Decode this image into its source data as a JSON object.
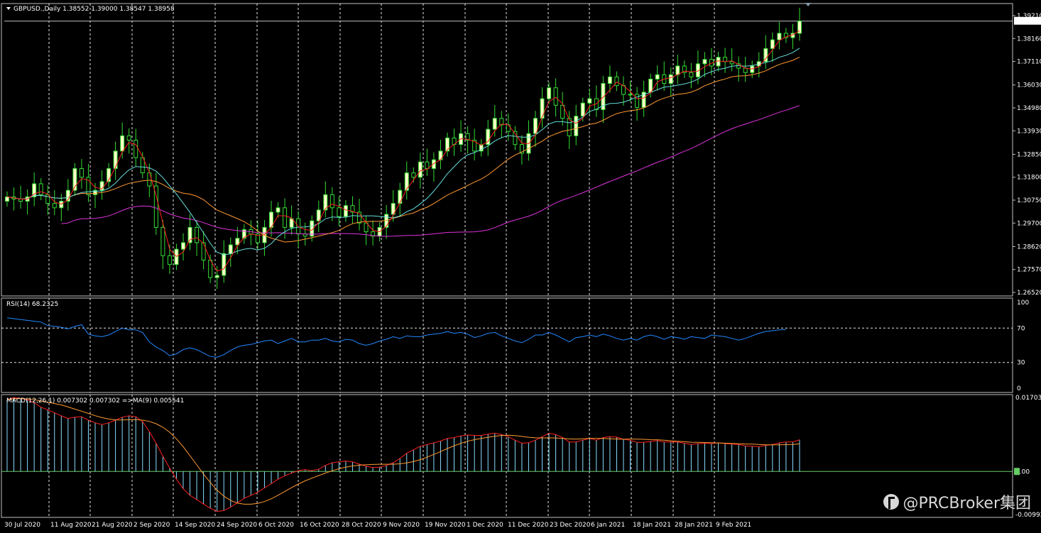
{
  "header": {
    "symbol_info": "GBPUSD.,Daily  1.38552 1.39000 1.38547 1.38958"
  },
  "rsi": {
    "label": "RSI(14) 68.2325",
    "levels": [
      "100",
      "70",
      "30",
      "0"
    ]
  },
  "macd": {
    "label": "MACD(12,26,1) 0.007302 0.007302  =>MA(9) 0.005541",
    "levels": [
      "0.017035",
      "0.00",
      "-0.00992"
    ]
  },
  "price_axis": {
    "labels": [
      "1.39210",
      "1.38160",
      "1.37110",
      "1.36030",
      "1.34980",
      "1.33930",
      "1.32850",
      "1.31800",
      "1.30750",
      "1.29700",
      "1.28620",
      "1.27570",
      "1.26520"
    ],
    "current": "1.38958"
  },
  "time_axis": {
    "labels": [
      "30 Jul 2020",
      "11 Aug 2020",
      "21 Aug 2020",
      "2 Sep 2020",
      "14 Sep 2020",
      "24 Sep 2020",
      "6 Oct 2020",
      "16 Oct 2020",
      "28 Oct 2020",
      "9 Nov 2020",
      "19 Nov 2020",
      "1 Dec 2020",
      "11 Dec 2020",
      "23 Dec 2020",
      "6 Jan 2021",
      "18 Jan 2021",
      "28 Jan 2021",
      "9 Feb 2021"
    ]
  },
  "watermark": {
    "text": "@PRCBroker集团"
  },
  "colors": {
    "bull": "#ffffc8",
    "bear": "#000000",
    "wick": "#33dd33",
    "ma_fast": "#ff2020",
    "ma_mid": "#66dddd",
    "ma_slow": "#ff9933",
    "ma_long": "#dd33dd",
    "rsi": "#2288ff",
    "macd_hist": "#88ddff",
    "macd_signal": "#ff9933",
    "macd_line": "#ff2020",
    "grid": "#ffffff"
  },
  "chart_data": [
    {
      "type": "candlestick",
      "title": "GBPUSD.,Daily",
      "categories": [
        "30 Jul 2020",
        "11 Aug 2020",
        "21 Aug 2020",
        "2 Sep 2020",
        "14 Sep 2020",
        "24 Sep 2020",
        "6 Oct 2020",
        "16 Oct 2020",
        "28 Oct 2020",
        "9 Nov 2020",
        "19 Nov 2020",
        "1 Dec 2020",
        "11 Dec 2020",
        "23 Dec 2020",
        "6 Jan 2021",
        "18 Jan 2021",
        "28 Jan 2021",
        "9 Feb 2021"
      ],
      "ylim": [
        1.2652,
        1.3921
      ],
      "series": [
        {
          "values": [
            1.309,
            1.308,
            1.307,
            1.309,
            1.315,
            1.31,
            1.306,
            1.304,
            1.307,
            1.312,
            1.322,
            1.318,
            1.31,
            1.312,
            1.316,
            1.322,
            1.33,
            1.337,
            1.335,
            1.327,
            1.32,
            1.314,
            1.295,
            1.282,
            1.278,
            1.285,
            1.288,
            1.295,
            1.288,
            1.28,
            1.272,
            1.273,
            1.283,
            1.287,
            1.29,
            1.294,
            1.292,
            1.288,
            1.295,
            1.302,
            1.304,
            1.295,
            1.299,
            1.292,
            1.291,
            1.298,
            1.303,
            1.31,
            1.304,
            1.3,
            1.305,
            1.302,
            1.297,
            1.293,
            1.291,
            1.295,
            1.301,
            1.306,
            1.312,
            1.32,
            1.318,
            1.325,
            1.322,
            1.326,
            1.33,
            1.336,
            1.333,
            1.338,
            1.335,
            1.33,
            1.333,
            1.34,
            1.345,
            1.342,
            1.339,
            1.333,
            1.329,
            1.338,
            1.345,
            1.354,
            1.359,
            1.351,
            1.345,
            1.337,
            1.346,
            1.352,
            1.354,
            1.349,
            1.361,
            1.364,
            1.36,
            1.356,
            1.356,
            1.35,
            1.357,
            1.363,
            1.365,
            1.361,
            1.365,
            1.369,
            1.366,
            1.364,
            1.37,
            1.372,
            1.369,
            1.373,
            1.371,
            1.37,
            1.368,
            1.366,
            1.369,
            1.371,
            1.377,
            1.381,
            1.384,
            1.382,
            1.384,
            1.3896
          ]
        }
      ]
    },
    {
      "type": "line",
      "title": "RSI(14) 68.2325",
      "ylim": [
        0,
        100
      ],
      "levels": [
        70,
        30
      ],
      "series": [
        {
          "values": [
            82,
            81,
            80,
            79,
            78,
            77,
            73,
            72,
            71,
            69,
            72,
            74,
            63,
            61,
            60,
            62,
            66,
            70,
            68,
            68,
            65,
            54,
            48,
            44,
            38,
            40,
            45,
            47,
            45,
            41,
            37,
            36,
            39,
            44,
            48,
            50,
            51,
            53,
            55,
            56,
            52,
            55,
            58,
            54,
            54,
            56,
            56,
            58,
            55,
            54,
            57,
            56,
            52,
            50,
            52,
            55,
            57,
            60,
            58,
            61,
            60,
            60,
            62,
            63,
            64,
            66,
            64,
            65,
            63,
            59,
            61,
            64,
            65,
            61,
            58,
            55,
            53,
            57,
            62,
            62,
            65,
            62,
            58,
            54,
            59,
            60,
            62,
            60,
            63,
            61,
            58,
            56,
            58,
            56,
            60,
            62,
            60,
            57,
            60,
            59,
            57,
            60,
            59,
            58,
            62,
            61,
            60,
            58,
            56,
            58,
            61,
            64,
            66,
            67,
            68,
            68.2325
          ]
        }
      ]
    },
    {
      "type": "bar",
      "title": "MACD(12,26,1) 0.007302 0.007302  =>MA(9) 0.005541",
      "ylim": [
        -0.00992,
        0.017035
      ],
      "series": [
        {
          "values": [
            0.0165,
            0.017,
            0.0168,
            0.0165,
            0.0158,
            0.0148,
            0.0142,
            0.0135,
            0.0128,
            0.0122,
            0.0125,
            0.0126,
            0.0118,
            0.0112,
            0.0108,
            0.0112,
            0.0118,
            0.0125,
            0.0128,
            0.0126,
            0.0115,
            0.0092,
            0.0065,
            0.0035,
            0.0008,
            -0.0018,
            -0.004,
            -0.0055,
            -0.0065,
            -0.0075,
            -0.0085,
            -0.0092,
            -0.009,
            -0.0082,
            -0.0072,
            -0.0062,
            -0.0055,
            -0.0048,
            -0.0038,
            -0.0028,
            -0.0018,
            -0.001,
            -0.0004,
            0.0002,
            0.0004,
            0.0002,
            0.0005,
            0.0014,
            0.002,
            0.0022,
            0.0024,
            0.0022,
            0.0017,
            0.0012,
            0.0009,
            0.001,
            0.0014,
            0.002,
            0.003,
            0.0042,
            0.005,
            0.0058,
            0.0062,
            0.0066,
            0.007,
            0.0076,
            0.0078,
            0.0082,
            0.0084,
            0.0083,
            0.0083,
            0.0086,
            0.0088,
            0.0085,
            0.008,
            0.0072,
            0.0065,
            0.0066,
            0.0072,
            0.008,
            0.0088,
            0.0085,
            0.0078,
            0.0068,
            0.0068,
            0.0072,
            0.0076,
            0.0072,
            0.0078,
            0.008,
            0.0079,
            0.0074,
            0.0072,
            0.0067,
            0.0067,
            0.0069,
            0.0071,
            0.0068,
            0.0068,
            0.0068,
            0.0065,
            0.0062,
            0.0064,
            0.0065,
            0.0064,
            0.0066,
            0.0064,
            0.0063,
            0.0062,
            0.0059,
            0.0058,
            0.0057,
            0.006,
            0.0062,
            0.0066,
            0.0068,
            0.0068,
            0.0073
          ]
        }
      ]
    }
  ]
}
